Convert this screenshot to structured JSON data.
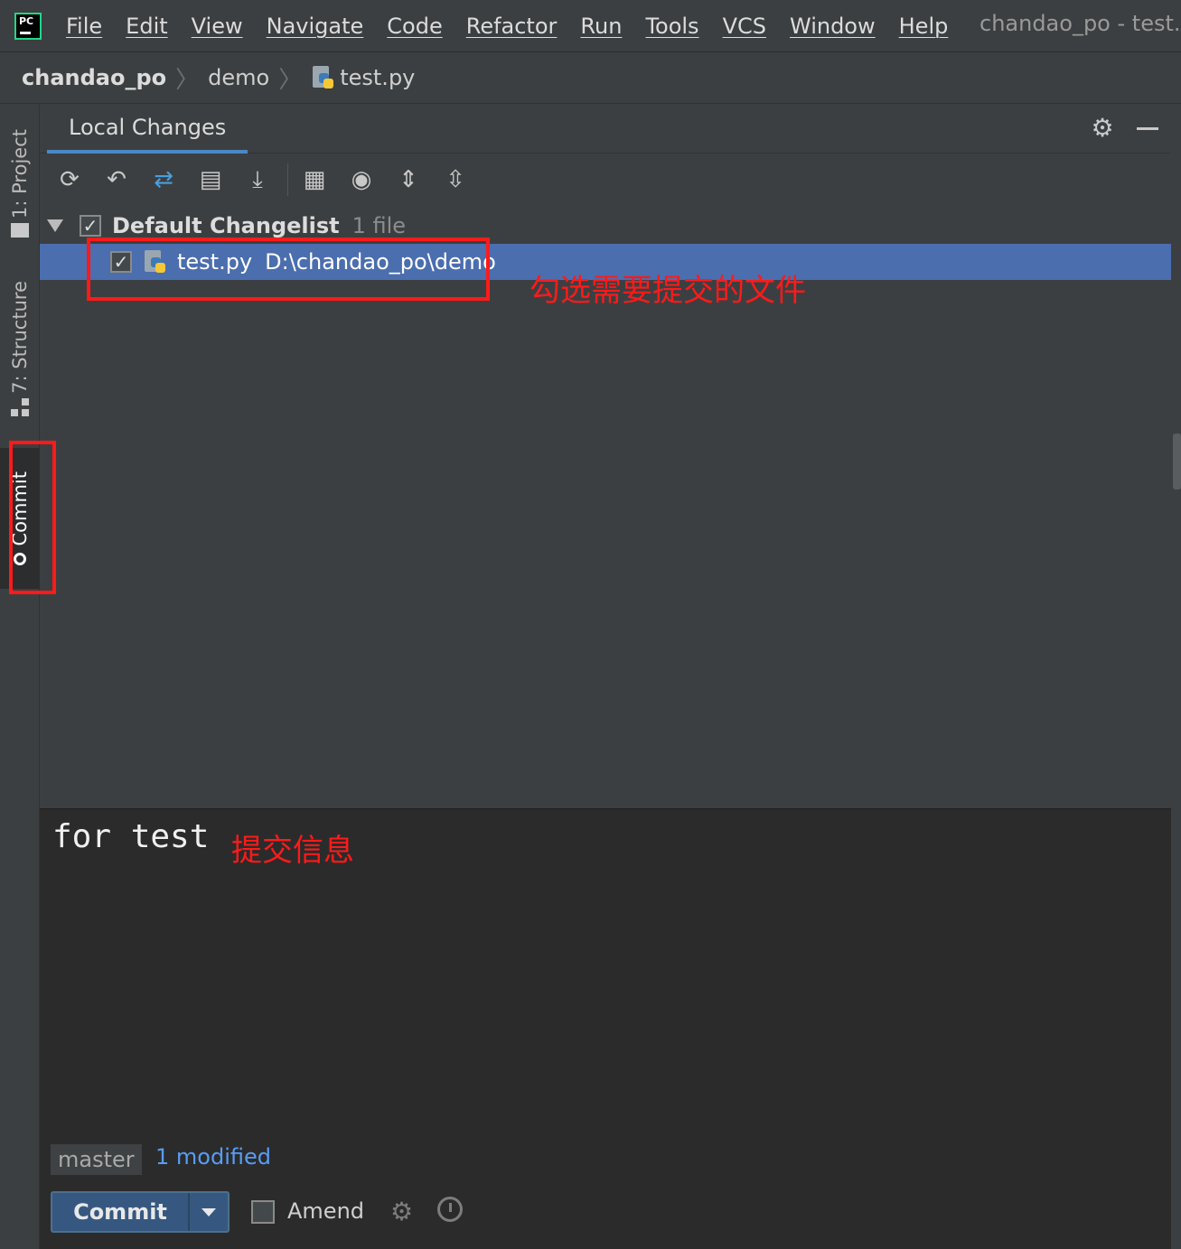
{
  "menubar": {
    "items": [
      "File",
      "Edit",
      "View",
      "Navigate",
      "Code",
      "Refactor",
      "Run",
      "Tools",
      "VCS",
      "Window",
      "Help"
    ],
    "window_title": "chandao_po - test.p"
  },
  "breadcrumb": {
    "project": "chandao_po",
    "folder": "demo",
    "file": "test.py"
  },
  "tool_strip": {
    "project": "1: Project",
    "structure": "7: Structure",
    "commit": "Commit"
  },
  "panel": {
    "tab": "Local Changes"
  },
  "tree": {
    "group_name": "Default Changelist",
    "group_count": "1 file",
    "file_name": "test.py",
    "file_path": "D:\\chandao_po\\demo"
  },
  "commit_message": "for test",
  "status": {
    "branch": "master",
    "modified": "1 modified"
  },
  "actions": {
    "commit_label": "Commit",
    "amend_label": "Amend"
  },
  "annotations": {
    "select_files": "勾选需要提交的文件",
    "commit_info": "提交信息"
  },
  "colors": {
    "selection": "#4b6eaf",
    "accent": "#4a88c7",
    "annotation": "#ff1a1a"
  }
}
